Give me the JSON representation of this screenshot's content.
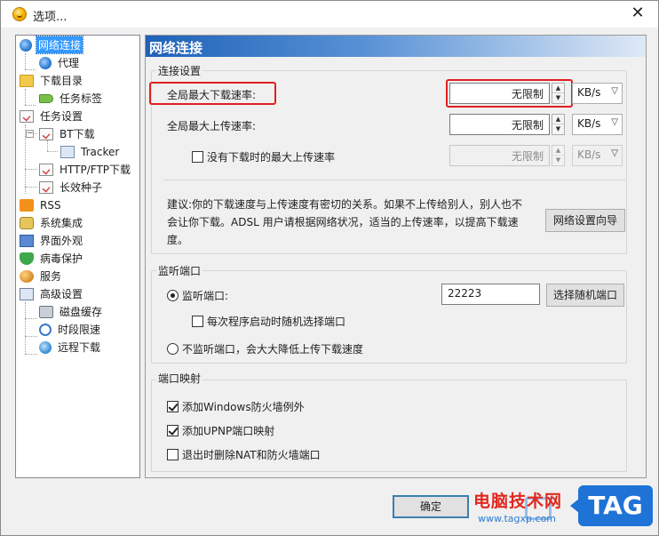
{
  "window": {
    "title": "选项...",
    "close_glyph": "✕"
  },
  "tree": {
    "items": [
      {
        "label": "网络连接",
        "icon": "globe-icon"
      },
      {
        "label": "代理",
        "icon": "globe-icon"
      },
      {
        "label": "下载目录",
        "icon": "folder-icon"
      },
      {
        "label": "任务标签",
        "icon": "tag-icon"
      },
      {
        "label": "任务设置",
        "icon": "task-icon"
      },
      {
        "label": "BT下载",
        "icon": "task-icon"
      },
      {
        "label": "Tracker",
        "icon": "box-icon"
      },
      {
        "label": "HTTP/FTP下载",
        "icon": "task-icon"
      },
      {
        "label": "长效种子",
        "icon": "task-icon"
      },
      {
        "label": "RSS",
        "icon": "rss-icon"
      },
      {
        "label": "系统集成",
        "icon": "plugin-icon"
      },
      {
        "label": "界面外观",
        "icon": "ui-icon"
      },
      {
        "label": "病毒保护",
        "icon": "shield-icon"
      },
      {
        "label": "服务",
        "icon": "users-icon"
      },
      {
        "label": "高级设置",
        "icon": "settings-icon"
      },
      {
        "label": "磁盘缓存",
        "icon": "disk-icon"
      },
      {
        "label": "时段限速",
        "icon": "clock-icon"
      },
      {
        "label": "远程下载",
        "icon": "remote-icon"
      }
    ]
  },
  "panel": {
    "title": "网络连接",
    "connection": {
      "legend": "连接设置",
      "max_download_label": "全局最大下载速率:",
      "max_download_value": "无限制",
      "max_download_unit": "KB/s",
      "max_upload_label": "全局最大上传速率:",
      "max_upload_value": "无限制",
      "max_upload_unit": "KB/s",
      "idle_upload_label": "没有下载时的最大上传速率",
      "idle_upload_value": "无限制",
      "idle_upload_unit": "KB/s",
      "hint": "建议:你的下载速度与上传速度有密切的关系。如果不上传给别人，别人也不会让你下载。ADSL 用户请根据网络状况，适当的上传速率，以提高下载速度。",
      "wizard_button": "网络设置向导"
    },
    "listen": {
      "legend": "监听端口",
      "listen_radio": "监听端口:",
      "port_value": "22223",
      "random_port_button": "选择随机端口",
      "random_on_start": "每次程序启动时随机选择端口",
      "no_listen_radio": "不监听端口，会大大降低上传下载速度"
    },
    "mapping": {
      "legend": "端口映射",
      "firewall_exception": "添加Windows防火墙例外",
      "upnp": "添加UPNP端口映射",
      "delete_on_exit": "退出时删除NAT和防火墙端口"
    }
  },
  "footer": {
    "ok_button": "确定"
  },
  "watermark": {
    "text": "电脑技术网",
    "url": "www.tagxp.com",
    "tag": "TAG"
  },
  "colors": {
    "header_blue": "#1f62b8",
    "selected": "#3399ff",
    "highlight_red": "#e02020"
  }
}
